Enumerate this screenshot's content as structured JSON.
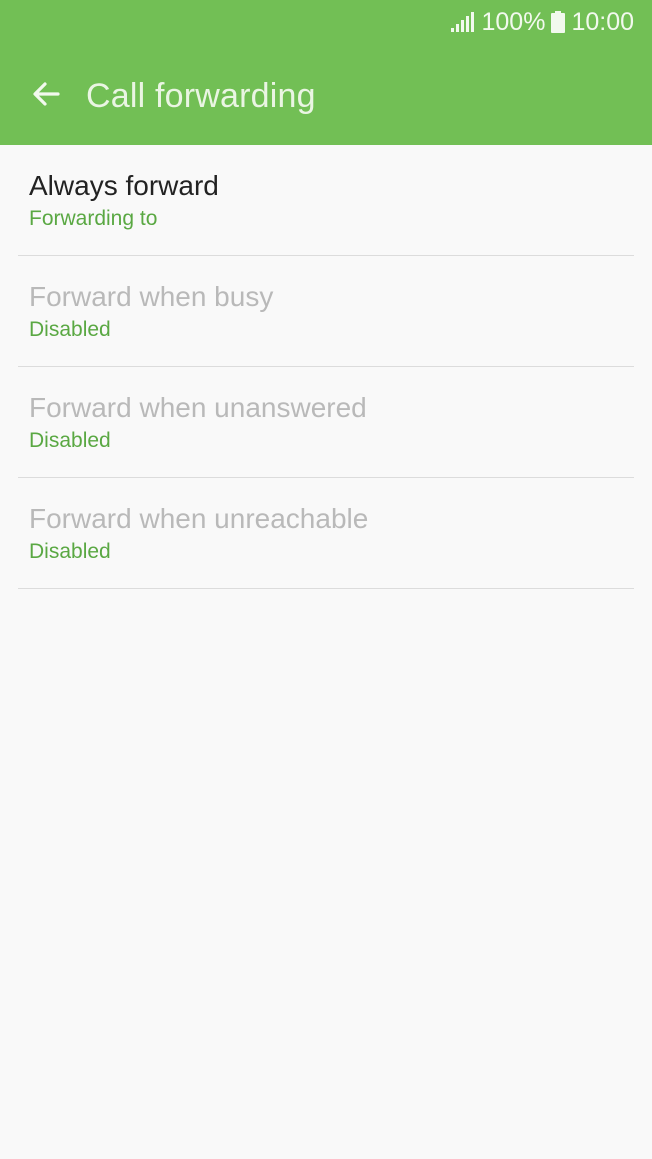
{
  "status_bar": {
    "battery": "100%",
    "time": "10:00"
  },
  "app_bar": {
    "title": "Call forwarding"
  },
  "items": [
    {
      "title": "Always forward",
      "subtitle": "Forwarding to"
    },
    {
      "title": "Forward when busy",
      "subtitle": "Disabled"
    },
    {
      "title": "Forward when unanswered",
      "subtitle": "Disabled"
    },
    {
      "title": "Forward when unreachable",
      "subtitle": "Disabled"
    }
  ],
  "colors": {
    "accent": "#72bf55",
    "subtitle": "#5aa843",
    "disabled_text": "#b9b9b9"
  },
  "icons": [
    "signal-icon",
    "battery-icon",
    "back-arrow-icon"
  ]
}
